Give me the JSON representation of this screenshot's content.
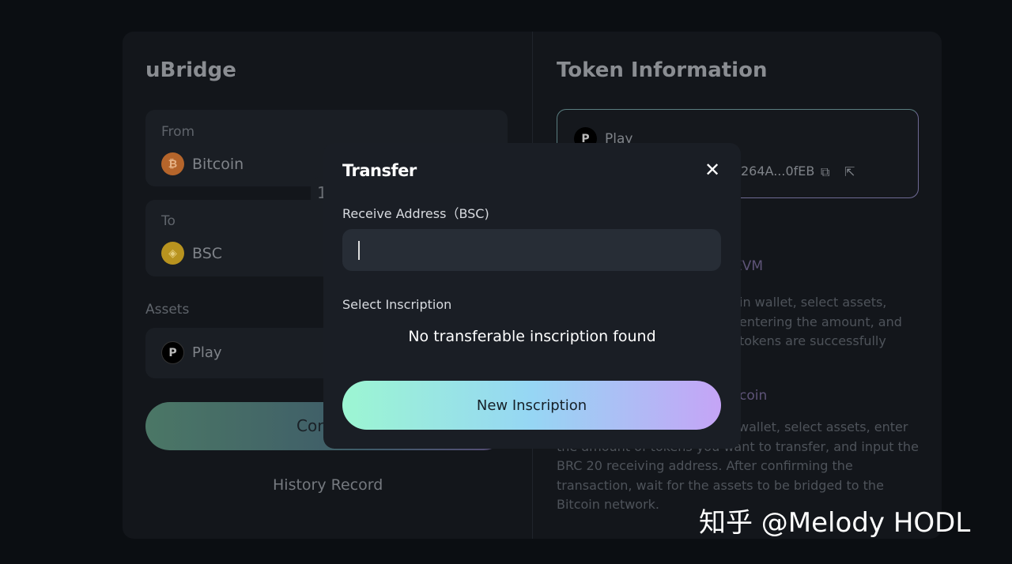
{
  "bridge": {
    "title": "uBridge",
    "from_label": "From",
    "from_value": "Bitcoin",
    "to_label": "To",
    "to_value": "BSC",
    "swap_hint": "1",
    "assets_label": "Assets",
    "asset_value": "Play",
    "asset_icon_letter": "P",
    "confirm_label_visible": "Cor",
    "history": "History Record"
  },
  "token": {
    "title": "Token Information",
    "name": "Play",
    "icon_letter": "P",
    "address": "264A...0fEB",
    "section1_heading_visible": "EVM",
    "section1_lines": [
      "in wallet, select assets,",
      "entering the amount, and",
      "tokens are successfully"
    ],
    "section2_heading_visible": "coin",
    "section2_lines": [
      "wallet, select assets, enter",
      "the amount of tokens you want to transfer, and input the",
      "BRC 20 receiving address. After confirming the",
      "transaction, wait for the assets to be bridged to the",
      "Bitcoin network."
    ]
  },
  "modal": {
    "title": "Transfer",
    "receive_label": "Receive Address（BSC)",
    "receive_value": "",
    "select_label": "Select Inscription",
    "empty_text": "No transferable inscription found",
    "new_button": "New Inscription"
  },
  "watermark": "知乎 @Melody HODL",
  "colors": {
    "bitcoin": "#c66f2e",
    "bsc": "#c9a227",
    "accent_start": "#9cf6d2",
    "accent_end": "#c5a4f6"
  }
}
